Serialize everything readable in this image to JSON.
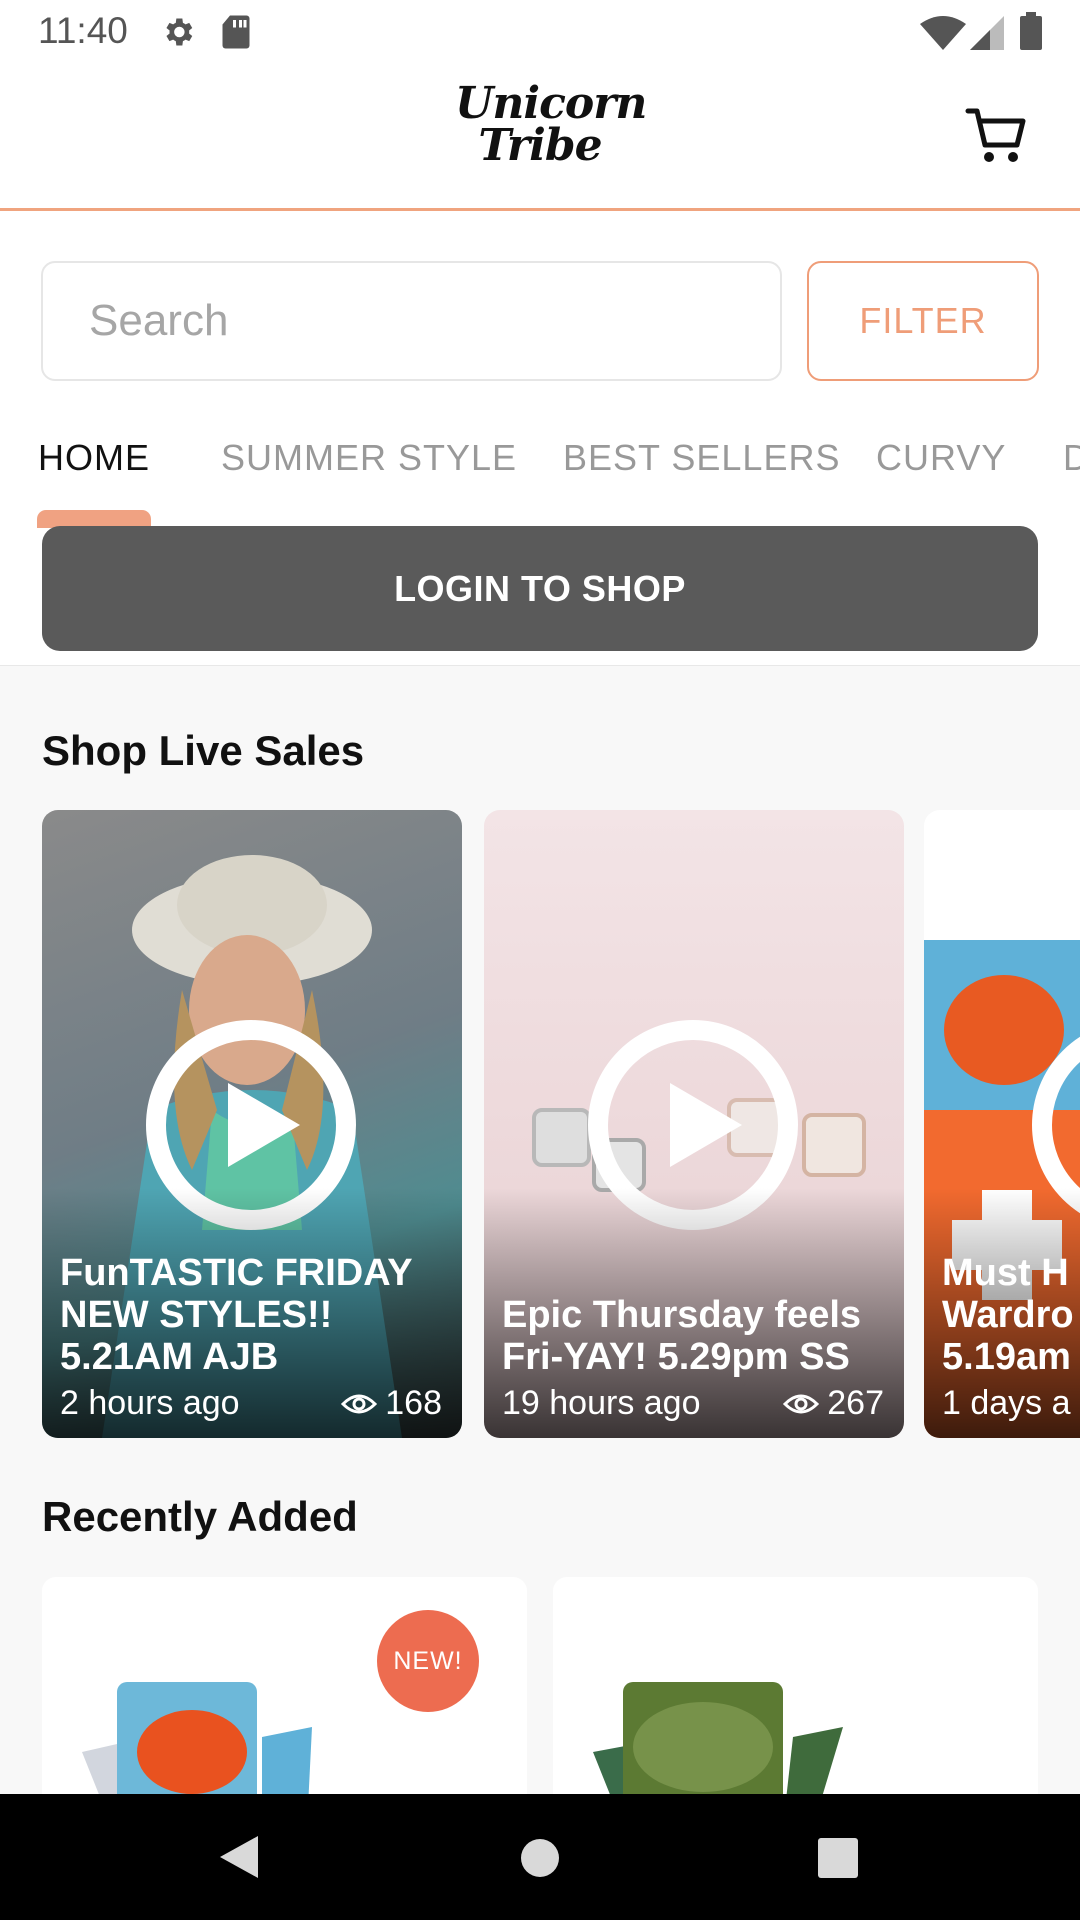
{
  "status_bar": {
    "time": "11:40",
    "icons": [
      "settings-icon",
      "sd-card-icon",
      "wifi-icon",
      "signal-icon",
      "battery-icon"
    ]
  },
  "header": {
    "logo_line1": "Unicorn",
    "logo_line2": "Tribe",
    "cart_icon": "cart-icon"
  },
  "search": {
    "placeholder": "Search",
    "filter_label": "FILTER"
  },
  "tabs": [
    {
      "label": "HOME"
    },
    {
      "label": "SUMMER STYLE"
    },
    {
      "label": "BEST SELLERS"
    },
    {
      "label": "CURVY"
    },
    {
      "label": "D"
    }
  ],
  "login": {
    "label": "LOGIN TO SHOP"
  },
  "live_sales": {
    "title": "Shop Live Sales",
    "cards": [
      {
        "title": "FunTASTIC FRIDAY NEW STYLES!! 5.21AM AJB",
        "time": "2 hours ago",
        "views": "168"
      },
      {
        "title": "Epic Thursday feels Fri-YAY! 5.29pm SS",
        "time": "19 hours ago",
        "views": "267"
      },
      {
        "title": "Must H Wardro 5.19am",
        "time": "1 days a",
        "views": ""
      }
    ]
  },
  "recently_added": {
    "title": "Recently Added",
    "badge": "NEW!"
  },
  "colors": {
    "accent": "#ef9d78",
    "badge": "#ed6c50",
    "login_bg": "#5a5a5a"
  }
}
